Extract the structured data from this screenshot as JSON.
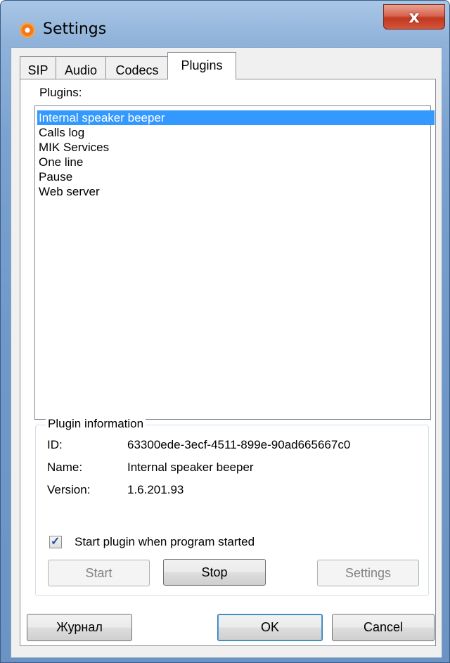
{
  "window": {
    "title": "Settings",
    "close_label": "x"
  },
  "tabs": [
    {
      "label": "SIP"
    },
    {
      "label": "Audio"
    },
    {
      "label": "Codecs"
    },
    {
      "label": "Plugins"
    }
  ],
  "active_tab": "Plugins",
  "plugins": {
    "list_label": "Plugins:",
    "items": [
      "Internal speaker beeper",
      "Calls log",
      "MIK Services",
      "One line",
      "Pause",
      "Web server"
    ],
    "selected_index": 0
  },
  "info": {
    "group_title": "Plugin information",
    "id_label": "ID:",
    "id_value": "63300ede-3ecf-4511-899e-90ad665667c0",
    "name_label": "Name:",
    "name_value": "Internal speaker beeper",
    "version_label": "Version:",
    "version_value": "1.6.201.93",
    "autostart_label": "Start plugin when program started",
    "autostart_checked": true,
    "start_label": "Start",
    "stop_label": "Stop",
    "settings_label": "Settings"
  },
  "footer": {
    "journal_label": "Журнал",
    "ok_label": "OK",
    "cancel_label": "Cancel"
  },
  "colors": {
    "selection": "#3399ff",
    "window_frame": "#7aa1cf",
    "close_button": "#c1391f"
  }
}
